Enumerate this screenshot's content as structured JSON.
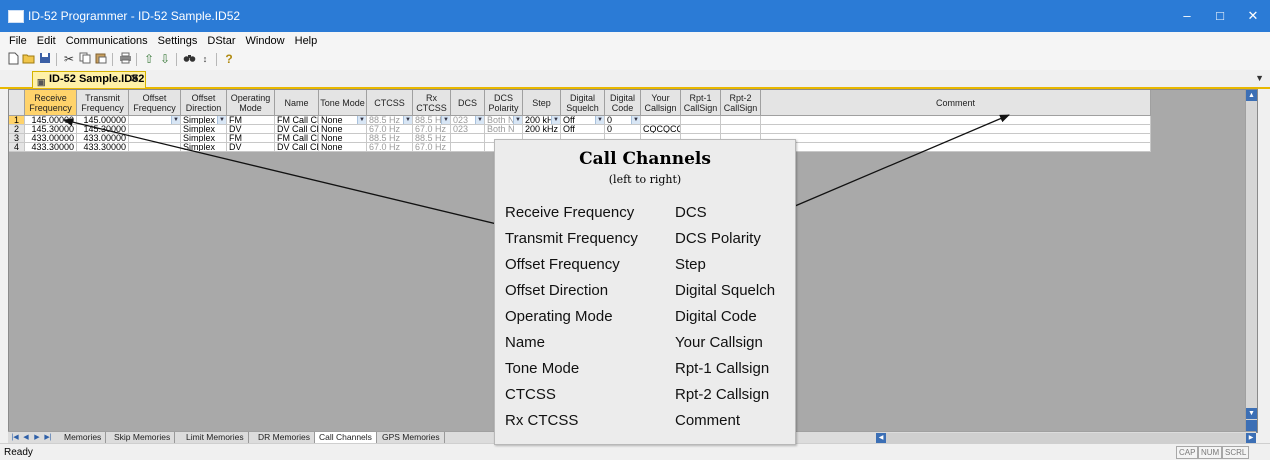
{
  "window": {
    "title": "ID-52 Programmer - ID-52 Sample.ID52",
    "controls": [
      "–",
      "□",
      "✕"
    ]
  },
  "menu": [
    "File",
    "Edit",
    "Communications",
    "Settings",
    "DStar",
    "Window",
    "Help"
  ],
  "toolbar_icons": [
    "new-icon",
    "open-icon",
    "save-icon",
    "cut-icon",
    "copy-icon",
    "paste-icon",
    "print-icon",
    "read-icon",
    "write-icon",
    "find-icon",
    "sort-icon",
    "help-icon"
  ],
  "document_tab": {
    "label": "ID-52 Sample.ID52",
    "close": "✕"
  },
  "columns": [
    "Receive\nFrequency",
    "Transmit\nFrequency",
    "Offset\nFrequency",
    "Offset\nDirection",
    "Operating\nMode",
    "Name",
    "Tone Mode",
    "CTCSS",
    "Rx\nCTCSS",
    "DCS",
    "DCS\nPolarity",
    "Step",
    "Digital\nSquelch",
    "Digital\nCode",
    "Your\nCallsign",
    "Rpt-1\nCallSign",
    "Rpt-2\nCallSign",
    "Comment"
  ],
  "rows": [
    {
      "num": "1",
      "rx": "145.00000",
      "tx": "145.00000",
      "offset": "",
      "dir": "Simplex",
      "mode": "FM",
      "name": "FM Call CH",
      "tone": "None",
      "ctcss": "88.5 Hz",
      "rxctcss": "88.5 Hz",
      "dcs": "023",
      "pol": "Both N",
      "step": "200 kHz",
      "dsq": "Off",
      "dcode": "0",
      "your": "",
      "rpt1": "",
      "rpt2": "",
      "comment": ""
    },
    {
      "num": "2",
      "rx": "145.30000",
      "tx": "145.30000",
      "offset": "",
      "dir": "Simplex",
      "mode": "DV",
      "name": "DV Call CH",
      "tone": "None",
      "ctcss": "67.0 Hz",
      "rxctcss": "67.0 Hz",
      "dcs": "023",
      "pol": "Both N",
      "step": "200 kHz",
      "dsq": "Off",
      "dcode": "0",
      "your": "CQCQCQ",
      "rpt1": "",
      "rpt2": "",
      "comment": ""
    },
    {
      "num": "3",
      "rx": "433.00000",
      "tx": "433.00000",
      "offset": "",
      "dir": "Simplex",
      "mode": "FM",
      "name": "FM Call CH",
      "tone": "None",
      "ctcss": "88.5 Hz",
      "rxctcss": "88.5 Hz",
      "dcs": "",
      "pol": "",
      "step": "",
      "dsq": "",
      "dcode": "",
      "your": "",
      "rpt1": "",
      "rpt2": "",
      "comment": ""
    },
    {
      "num": "4",
      "rx": "433.30000",
      "tx": "433.30000",
      "offset": "",
      "dir": "Simplex",
      "mode": "DV",
      "name": "DV Call CH",
      "tone": "None",
      "ctcss": "67.0 Hz",
      "rxctcss": "67.0 Hz",
      "dcs": "",
      "pol": "",
      "step": "",
      "dsq": "",
      "dcode": "",
      "your": "",
      "rpt1": "",
      "rpt2": "",
      "comment": ""
    }
  ],
  "sheet_nav": [
    "|◀",
    "◀",
    "▶",
    "▶|"
  ],
  "sheet_tabs": [
    "Memories",
    "Skip Memories",
    "Limit Memories",
    "DR Memories",
    "Call Channels",
    "GPS Memories"
  ],
  "active_sheet": "Call Channels",
  "status": {
    "text": "Ready",
    "indicators": [
      "CAP",
      "NUM",
      "SCRL"
    ]
  },
  "callout": {
    "title": "Call Channels",
    "subtitle": "(left to right)",
    "left": [
      "Receive Frequency",
      "Transmit Frequency",
      "Offset Frequency",
      "Offset Direction",
      "Operating Mode",
      "Name",
      "Tone Mode",
      "CTCSS",
      "Rx CTCSS"
    ],
    "right": [
      "DCS",
      "DCS Polarity",
      "Step",
      "Digital Squelch",
      "Digital Code",
      "Your Callsign",
      "Rpt-1 Callsign",
      "Rpt-2 Callsign",
      "Comment"
    ]
  },
  "colors": {
    "titlebar": "#2b7bd6",
    "selected_header": "#ffd36b",
    "doc_tab": "#fff1a8",
    "grid_background": "#a9a9a9"
  }
}
